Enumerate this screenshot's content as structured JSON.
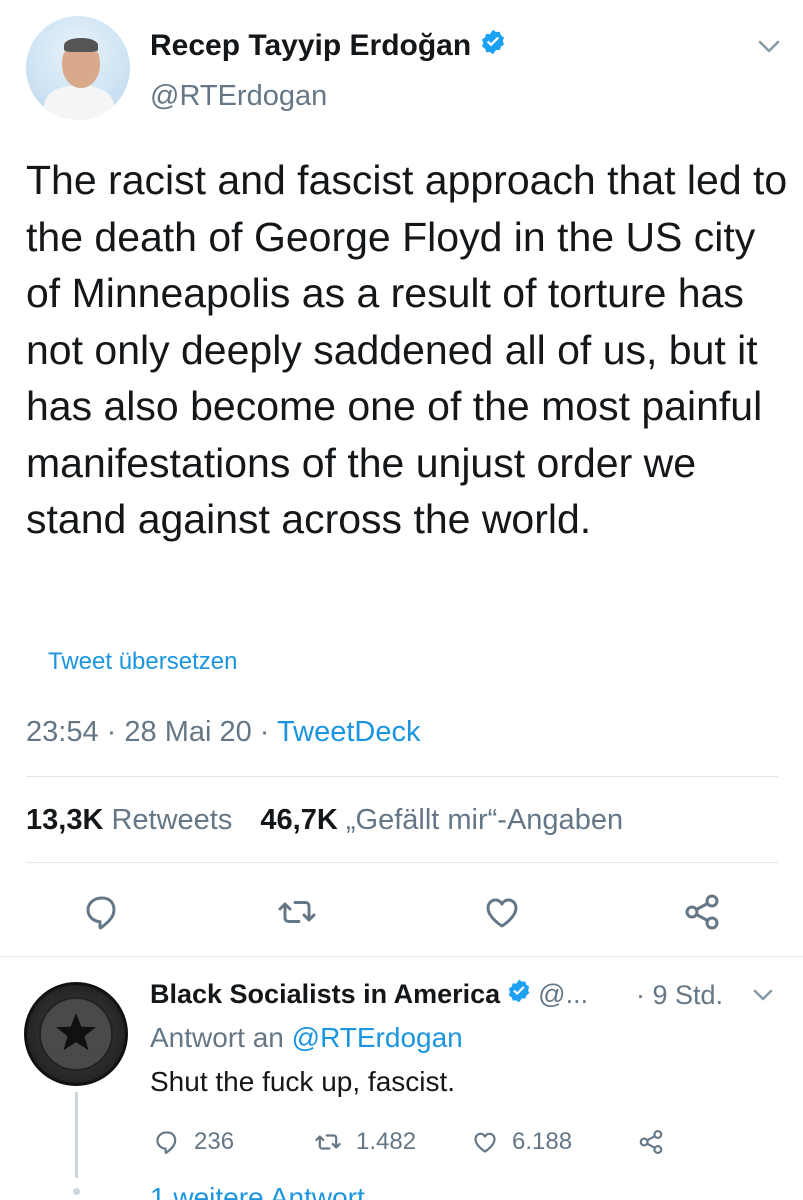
{
  "tweet": {
    "author_name": "Recep Tayyip Erdoğan",
    "handle": "@RTErdogan",
    "text": "The racist and fascist approach that led to the death of George Floyd in the US city of Minneapolis as a result of torture has not only deeply saddened all of us, but it has also become one of the most painful manifestations of the unjust order we stand against across the world.",
    "translate_label": "Tweet übersetzen",
    "time": "23:54",
    "date": "28 Mai 20",
    "source": "TweetDeck",
    "separator": "·",
    "retweet_count": "13,3K",
    "retweet_label": "Retweets",
    "like_count": "46,7K",
    "like_label": "„Gefällt mir“-Angaben"
  },
  "actions": {
    "icons": [
      "reply-icon",
      "retweet-icon",
      "like-icon",
      "share-icon"
    ]
  },
  "reply": {
    "author_name": "Black Socialists in America",
    "handle_truncated": "@...",
    "time": "· 9 Std.",
    "replying_prefix": "Antwort an",
    "replying_to": "@RTErdogan",
    "text": "Shut the fuck up, fascist.",
    "reply_count": "236",
    "retweet_count": "1.482",
    "like_count": "6.188",
    "more_replies": "1 weitere Antwort"
  },
  "colors": {
    "accent": "#1b95e0",
    "muted": "#657786",
    "text": "#14171a",
    "divider": "#e1e8ed"
  }
}
